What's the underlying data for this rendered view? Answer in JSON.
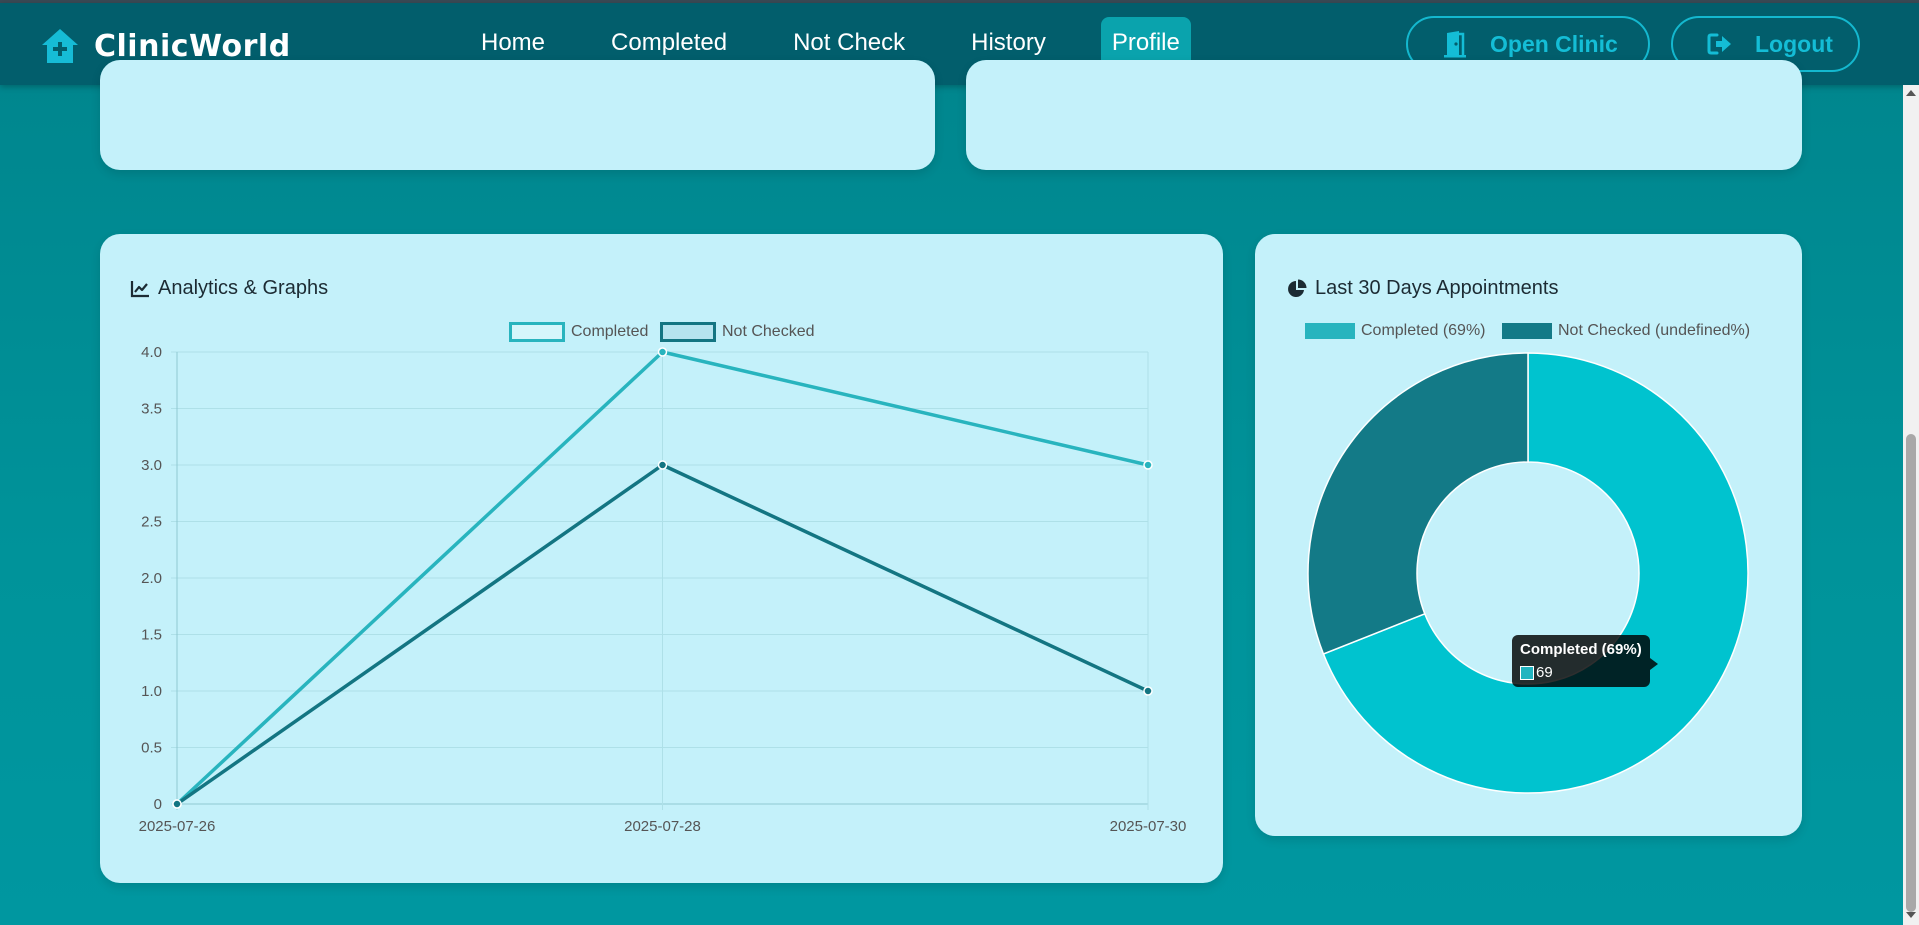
{
  "navbar": {
    "brand": "ClinicWorld",
    "links": [
      {
        "label": "Home"
      },
      {
        "label": "Completed"
      },
      {
        "label": "Not Check"
      },
      {
        "label": "History"
      },
      {
        "label": "Profile",
        "active": true
      }
    ],
    "open_clinic_label": "Open Clinic",
    "logout_label": "Logout"
  },
  "analytics": {
    "title": "Analytics & Graphs"
  },
  "pie_card": {
    "title": "Last 30 Days Appointments"
  },
  "colors": {
    "completed_line": "#28b4be",
    "not_checked_line": "#137582",
    "completed_slice": "#00c3cf",
    "not_checked_slice": "#137a87"
  },
  "tooltip": {
    "title": "Completed (69%)",
    "value": "69"
  },
  "chart_data": [
    {
      "type": "line",
      "x": [
        "2025-07-26",
        "2025-07-28",
        "2025-07-30"
      ],
      "series": [
        {
          "name": "Completed",
          "values": [
            0,
            4,
            3
          ]
        },
        {
          "name": "Not Checked",
          "values": [
            0,
            3,
            1
          ]
        }
      ],
      "ylim": [
        0,
        4
      ],
      "yticks": [
        "0",
        "0.5",
        "1.0",
        "1.5",
        "2.0",
        "2.5",
        "3.0",
        "3.5",
        "4.0"
      ],
      "grid": true,
      "legend": "top"
    },
    {
      "type": "pie",
      "labels": [
        "Completed (69%)",
        "Not Checked (undefined%)"
      ],
      "values": [
        69,
        31
      ],
      "legend": "top"
    }
  ]
}
